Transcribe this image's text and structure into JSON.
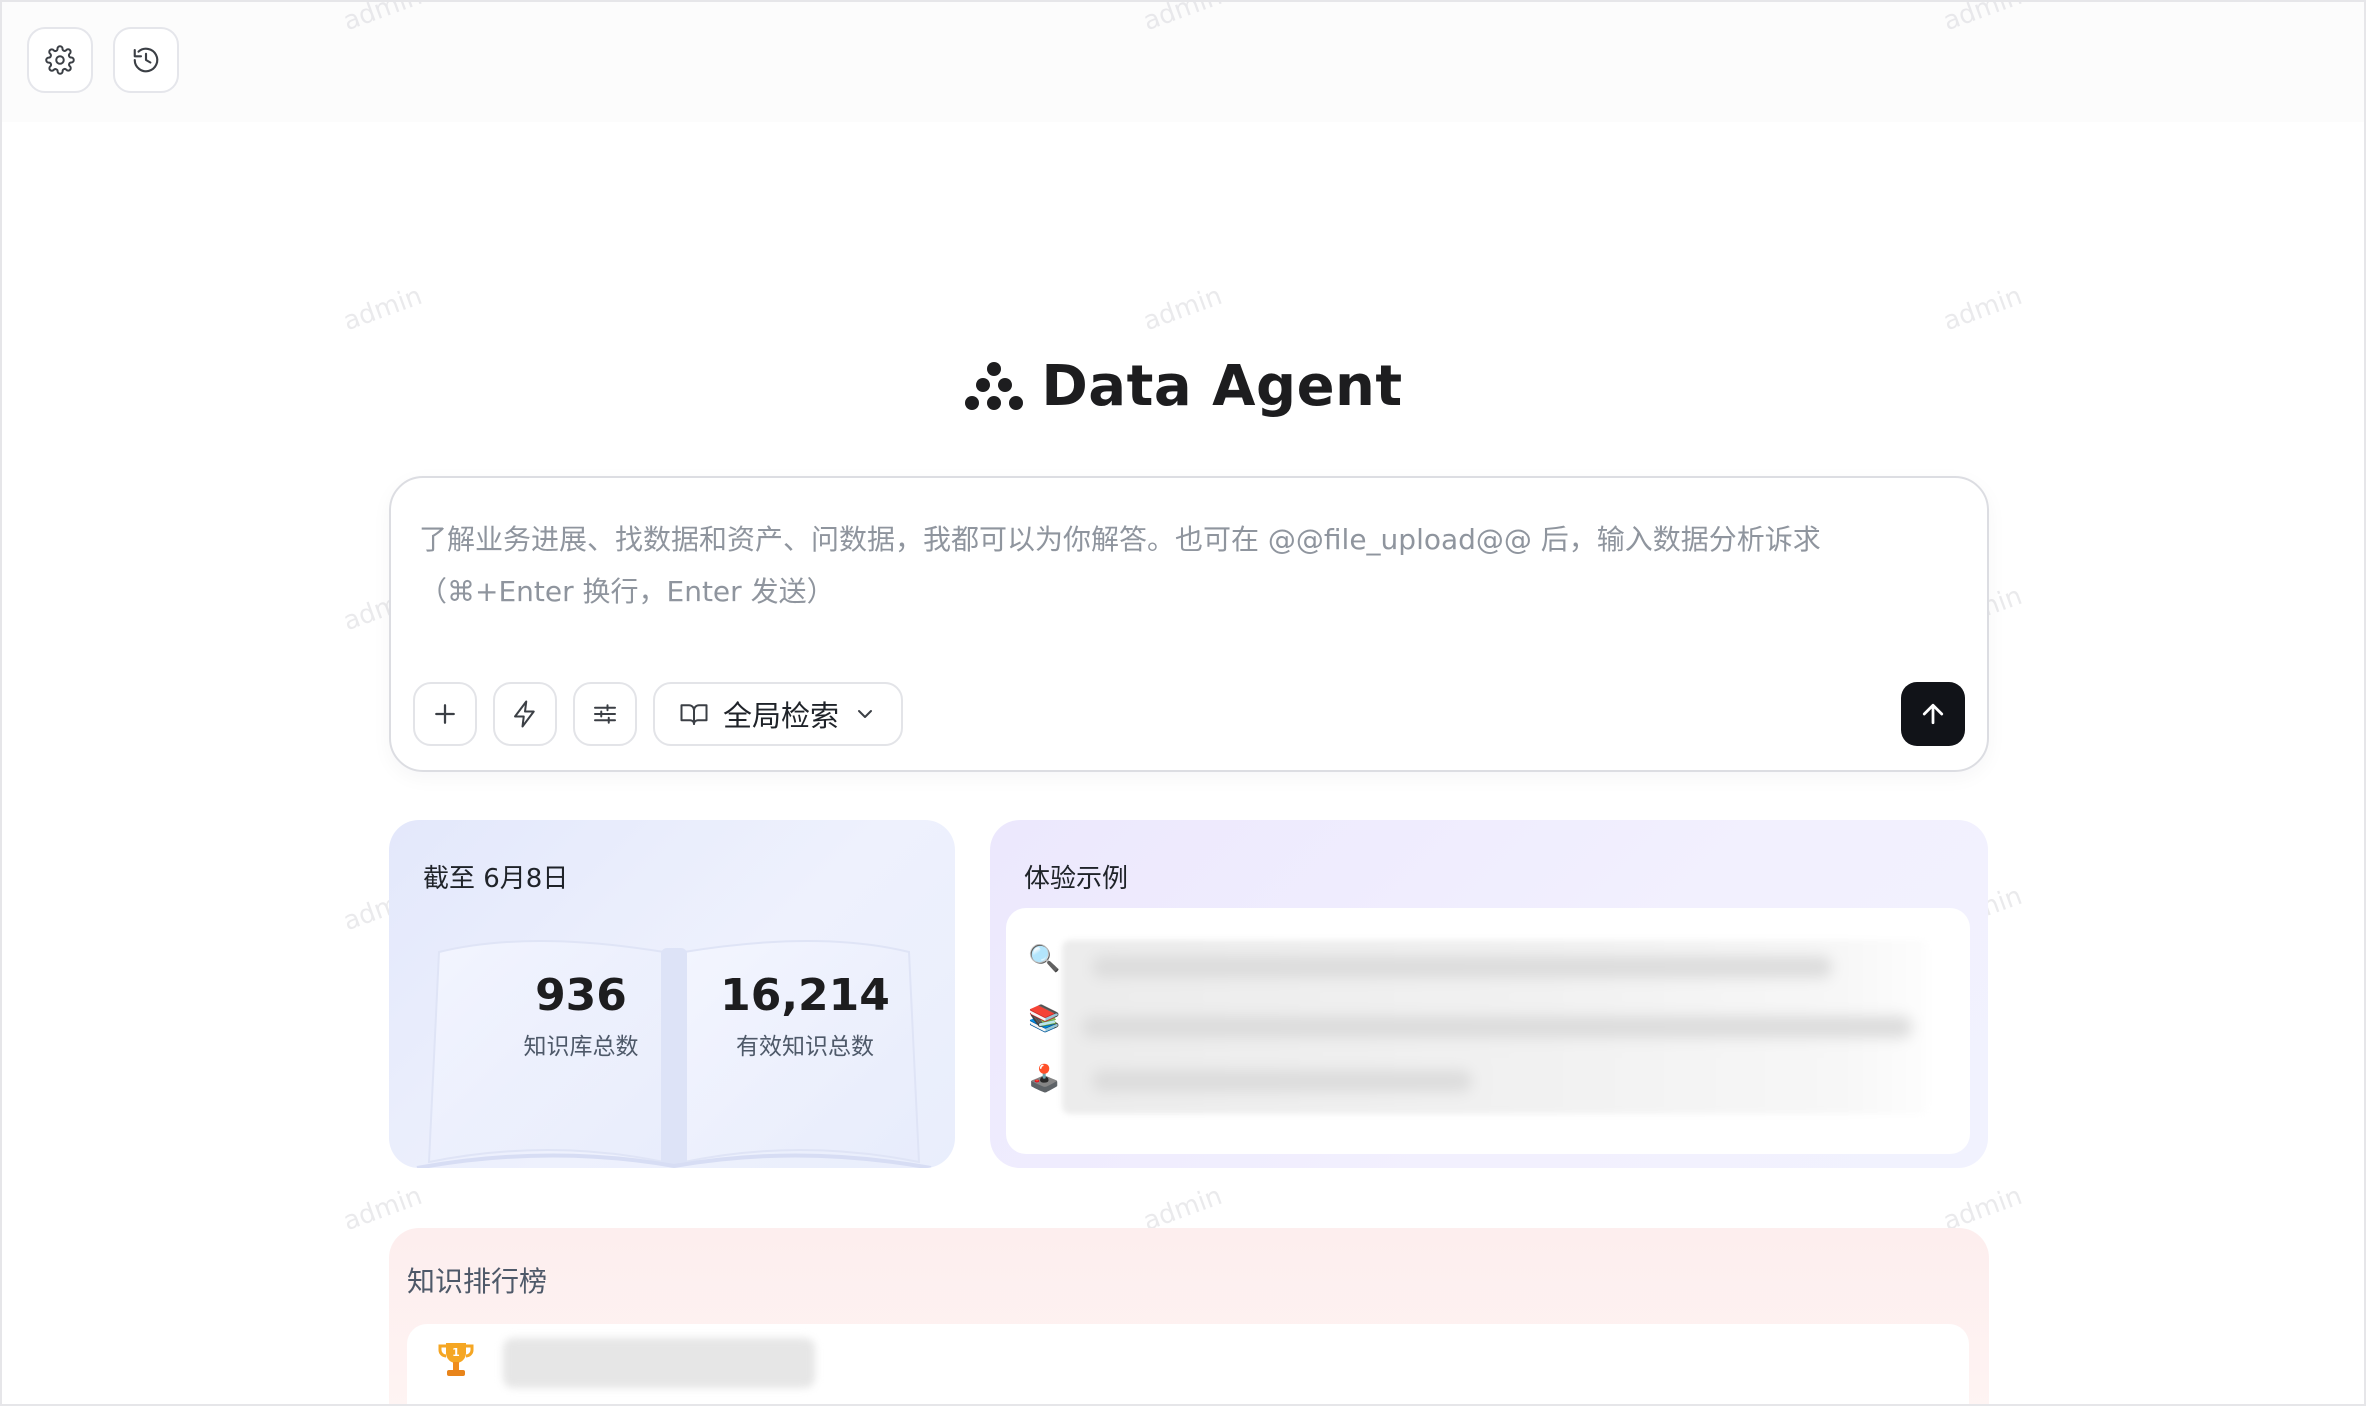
{
  "app": {
    "title": "Data Agent"
  },
  "toolbar": {
    "settings_icon": "gear-icon",
    "history_icon": "history-icon"
  },
  "watermark": "admin",
  "composer": {
    "placeholder": "了解业务进展、找数据和资产、问数据，我都可以为你解答。也可在 @@file_upload@@ 后，输入数据分析诉求（⌘+Enter 换行，Enter 发送）",
    "tools": [
      "plus-icon",
      "lightning-icon",
      "sliders-icon"
    ],
    "scope": {
      "icon": "book-open-icon",
      "label": "全局检索",
      "caret": "chevron-down-icon"
    },
    "send_icon": "arrow-up-icon"
  },
  "stats_card": {
    "title": "截至 6月8日",
    "items": [
      {
        "value": "936",
        "label": "知识库总数"
      },
      {
        "value": "16,214",
        "label": "有效知识总数"
      }
    ]
  },
  "examples_card": {
    "title": "体验示例",
    "items": [
      {
        "emoji": "🔍",
        "icon": "magnifier-icon"
      },
      {
        "emoji": "📚",
        "icon": "books-icon"
      },
      {
        "emoji": "🕹️",
        "icon": "joystick-icon"
      }
    ]
  },
  "rank_card": {
    "title": "知识排行榜",
    "first_icon": "trophy-icon"
  },
  "colors": {
    "accent_dark": "#111318",
    "stats_bg": "#e3e8fb",
    "examples_bg": "#ece8fd",
    "rank_bg": "#fdeeee",
    "trophy": "#f5a623"
  }
}
